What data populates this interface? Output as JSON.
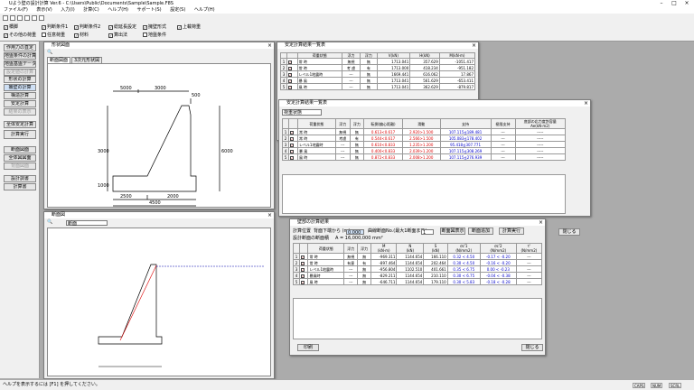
{
  "title": "Uよう壁の設計計算 Ver.6 - C:\\Users\\Public\\Documents\\Sample\\Sample.F8S",
  "menu": [
    "ファイル(F)",
    "表示(V)",
    "入力(I)",
    "計算(C)",
    "ヘルプ(H)",
    "サポート(S)",
    "設定(S)",
    "ヘルプ(H)"
  ],
  "opts_row1": [
    "橋脚",
    "判断条件1",
    "判断条件2",
    "総延長設定",
    "擁壁形式",
    "上載荷重"
  ],
  "opts_row2": [
    "その他の荷重",
    "任意荷重",
    "材料",
    "算出法",
    "地盤条件"
  ],
  "side": [
    "作用力の直定",
    "地盤条件の計算",
    "地盤基盤データ",
    "設定値の計算",
    "形状の計算",
    "擁壁の計算",
    "構造計算",
    "安定計算",
    "結果の表示",
    "全体安定計算",
    "計算実行",
    "断面図面",
    "全体図図面",
    "背面図面",
    "設計調書",
    "計算書"
  ],
  "w1": {
    "title": "形状図面",
    "tabs": [
      "断面図面",
      "3次元形状図"
    ],
    "dims": {
      "top1": "5000",
      "top2": "3000",
      "right": "500",
      "left": "3000",
      "height": "6000",
      "base": "1000",
      "bot1": "2500",
      "bot2": "2000",
      "bottom": "4500"
    }
  },
  "w2": {
    "title": "安定計算結果一覧表",
    "headers": [
      "",
      "",
      "荷重状態",
      "浮力",
      "浮力",
      "V(kN)",
      "H(kN)",
      "M(kN·m)"
    ],
    "rows": [
      [
        "1",
        "常 時",
        "無視",
        "無",
        "1713.041",
        "357.629",
        "-1051.417"
      ],
      [
        "2",
        "常 時",
        "考 慮",
        "有",
        "1713.000",
        "418.234",
        "-951.182"
      ],
      [
        "3",
        "レベル1地震時",
        "---",
        "無",
        "1669.441",
        "616.062",
        "17.867"
      ],
      [
        "4",
        "暴 風",
        "---",
        "無",
        "1713.041",
        "561.629",
        "-653.411"
      ],
      [
        "5",
        "風 時",
        "---",
        "無",
        "1713.041",
        "362.629",
        "-879.817"
      ]
    ]
  },
  "w3": {
    "title": "安定計算結果一覧表",
    "select": "荷重状態",
    "headers": [
      "荷重状態",
      "浮力",
      "浮力",
      "転倒(偏心距離)",
      "滑動",
      "支持",
      "極限支持",
      "底部の応力度許容量"
    ],
    "sub": "Ae(kN·m2)",
    "rows": [
      [
        "常 時",
        "無視",
        "無",
        "0.613<0.617",
        "2.920>1.500",
        "107.115≦189.481",
        "---",
        "-----"
      ],
      [
        "常 時",
        "考慮",
        "有",
        "0.544<0.617",
        "2.566>1.500",
        "105.083≦178.402",
        "---",
        "-----"
      ],
      [
        "レベル1地震時",
        "---",
        "無",
        "0.610<0.833",
        "1.235>1.200",
        "95.418≦307.771",
        "---",
        "-----"
      ],
      [
        "暴 風",
        "---",
        "無",
        "0.400<0.833",
        "2.039>1.200",
        "107.115≦308.269",
        "---",
        "-----"
      ],
      [
        "風 時",
        "---",
        "無",
        "0.872<0.833",
        "2.008>1.200",
        "107.115≦276.939",
        "---",
        "-----"
      ]
    ]
  },
  "w4": {
    "title": "断面図",
    "select": "断面"
  },
  "w5": {
    "title": "壁部の計算結果",
    "calc_label": "計算位置",
    "from_label": "背面下端から (m)",
    "from_val": "0.000",
    "n_label": "曲線断面No.(最大1断面まで)",
    "n_val": "1",
    "b1": "断面図表示",
    "b2": "断面追加",
    "b3": "計算実行",
    "close": "閉じる",
    "sub_label": "設計断面の断面積",
    "area": "A = 16,000,000 mm²",
    "headers": [
      "荷重状態",
      "浮力",
      "浮力",
      "M",
      "N",
      "S",
      "σc'1",
      "σc'2",
      "τ'"
    ],
    "units": [
      "(kN·m)",
      "(kN)",
      "(kN)",
      "(N/mm2)",
      "(N/mm2)",
      "(N/mm2)"
    ],
    "rows": [
      [
        "常 時",
        "無視",
        "無",
        "-969.311",
        "1144.654",
        "166.110",
        "0.32 < 4.50",
        "-0.17 < -0.20",
        "---"
      ],
      [
        "常 時",
        "有意",
        "有",
        "-897.464",
        "1144.654",
        "202.464",
        "0.30 < 4.50",
        "-0.16 < -0.20",
        "---"
      ],
      [
        "レベル1地震時",
        "---",
        "無",
        "-956.804",
        "1102.510",
        "401.661",
        "0.35 < 6.75",
        "0.00 < -0.23",
        "---"
      ],
      [
        "暴風時",
        "---",
        "無",
        "-829.211",
        "1144.654",
        "210.110",
        "0.30 < 6.75",
        "-0.04 < -0.38",
        "---"
      ],
      [
        "風 時",
        "---",
        "無",
        "-646.711",
        "1144.654",
        "179.110",
        "0.30 < 5.83",
        "-0.18 < -0.28",
        "---"
      ]
    ],
    "print": "印刷"
  },
  "status": "ヘルプを表示するには [F1] を押してください。",
  "status_boxes": [
    "CAPS",
    "NUM",
    "SCRL"
  ]
}
